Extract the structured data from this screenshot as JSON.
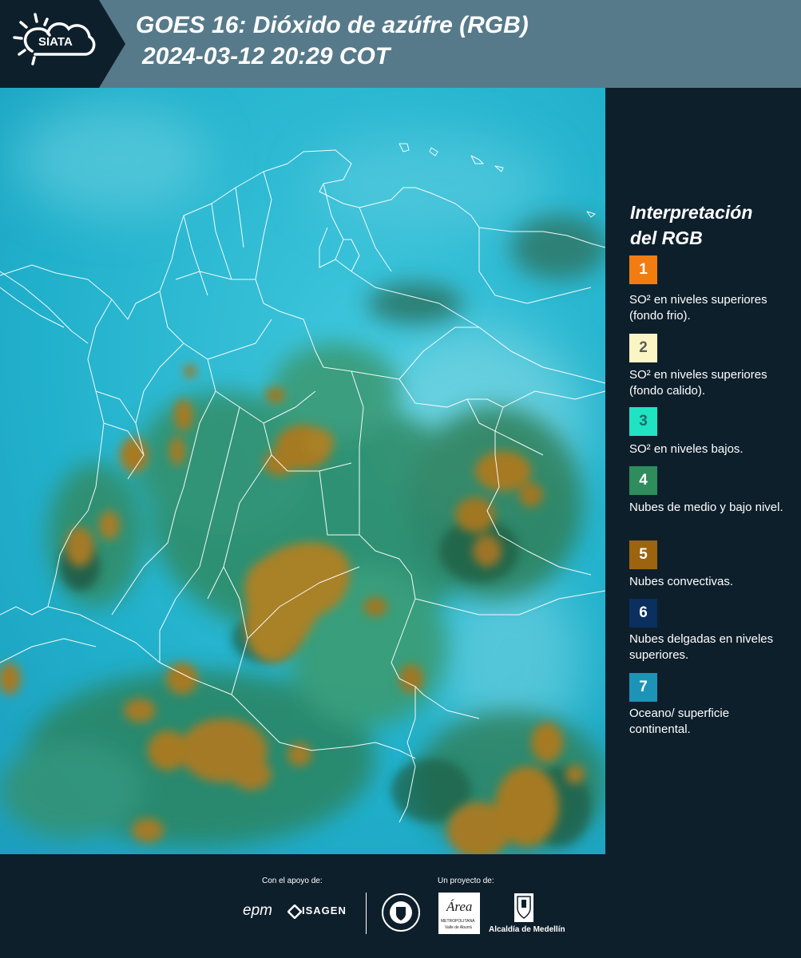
{
  "header": {
    "logo_text": "SIATA",
    "title_line1": "GOES 16: Dióxido de azúfre (RGB)",
    "title_line2": "2024-03-12 20:29 COT"
  },
  "legend": {
    "title_line1": "Interpretación",
    "title_line2": "del RGB",
    "items": [
      {
        "number": "1",
        "label": "SO² en niveles superiores (fondo frio).",
        "color": "#f27c12",
        "text_color": "#ffffff"
      },
      {
        "number": "2",
        "label": "SO² en niveles superiores (fondo calido).",
        "color": "#fbf4c4",
        "text_color": "#5a5a5a"
      },
      {
        "number": "3",
        "label": "SO² en niveles bajos.",
        "color": "#1fe3c3",
        "text_color": "#1d6b64"
      },
      {
        "number": "4",
        "label": "Nubes de medio y bajo nivel.",
        "color": "#2f8c5c",
        "text_color": "#ffffff"
      },
      {
        "number": "5",
        "label": "Nubes convectivas.",
        "color": "#9c640e",
        "text_color": "#ffffff"
      },
      {
        "number": "6",
        "label": "Nubes delgadas en niveles superiores.",
        "color": "#0b2f5e",
        "text_color": "#ffffff"
      },
      {
        "number": "7",
        "label": "Oceano/ superficie continental.",
        "color": "#1d93b8",
        "text_color": "#ffffff"
      }
    ]
  },
  "footer": {
    "support_label": "Con el apoyo de:",
    "project_label": "Un proyecto de:",
    "epm_logo": "epm",
    "isagen_logo": "ISAGEN",
    "area_logo": "Área",
    "area_sub1": "METROPOLITANA",
    "area_sub2": "Valle de Aburrá",
    "alcaldia_logo": "Alcaldía de Medellín"
  },
  "colors": {
    "background": "#0e1f2c",
    "header_band": "#567a8a",
    "ocean_cyan": "#1eb3cc",
    "convective_brown": "#a87c25",
    "midlevel_green": "#2f7e5a"
  }
}
